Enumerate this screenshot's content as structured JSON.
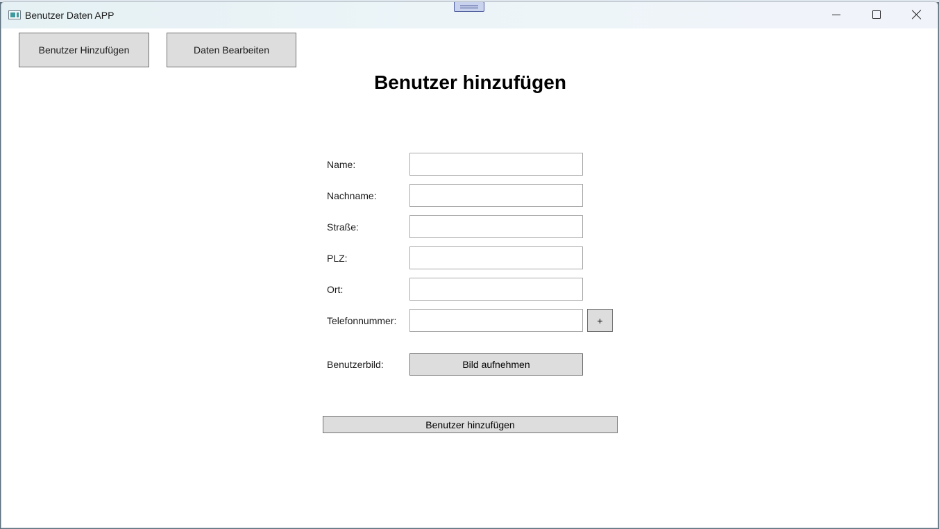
{
  "window": {
    "title": "Benutzer Daten APP",
    "controls": {
      "minimize": "minimize-icon",
      "maximize": "maximize-icon",
      "close": "close-icon"
    }
  },
  "nav": {
    "add_user": "Benutzer Hinzufügen",
    "edit_data": "Daten Bearbeiten"
  },
  "page": {
    "heading": "Benutzer hinzufügen"
  },
  "form": {
    "name_label": "Name:",
    "name_value": "",
    "lastname_label": "Nachname:",
    "lastname_value": "",
    "street_label": "Straße:",
    "street_value": "",
    "zip_label": "PLZ:",
    "zip_value": "",
    "city_label": "Ort:",
    "city_value": "",
    "phone_label": "Telefonnummer:",
    "phone_value": "",
    "add_phone_label": "+",
    "image_label": "Benutzerbild:",
    "take_photo_label": "Bild aufnehmen",
    "submit_label": "Benutzer hinzufügen"
  },
  "colors": {
    "titlebar": "#e5f1f4",
    "button_bg": "#dddddd",
    "button_border": "#707070",
    "field_border": "#a9a9a9"
  }
}
